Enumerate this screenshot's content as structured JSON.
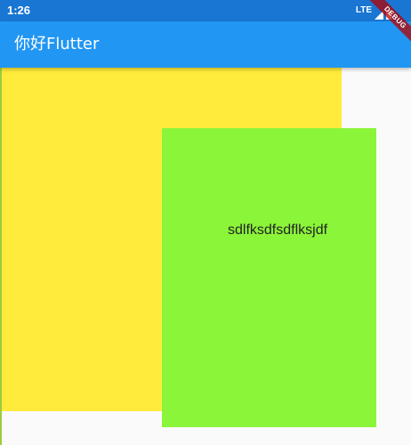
{
  "status_bar": {
    "time": "1:26",
    "network": "LTE",
    "signal_icon": "signal-icon",
    "battery_icon": "battery-icon"
  },
  "app_bar": {
    "title": "你好Flutter"
  },
  "debug_banner": {
    "label": "DEBUG"
  },
  "content": {
    "green_box_text": "sdlfksdfsdflksjdf"
  },
  "colors": {
    "status_bar": "#1976d2",
    "app_bar": "#2196f3",
    "yellow": "#ffeb3b",
    "green": "#8bf539",
    "background": "#fafafa"
  }
}
